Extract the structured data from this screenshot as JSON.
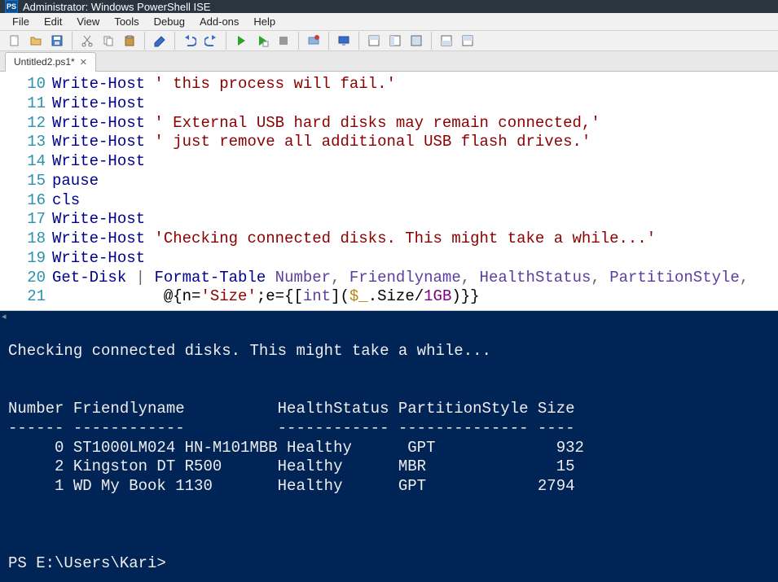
{
  "titlebar": {
    "title": "Administrator: Windows PowerShell ISE",
    "icon_label": "PS"
  },
  "menubar": {
    "items": [
      "File",
      "Edit",
      "View",
      "Tools",
      "Debug",
      "Add-ons",
      "Help"
    ]
  },
  "toolbar": {
    "new": "New",
    "open": "Open",
    "save": "Save",
    "cut": "Cut",
    "copy": "Copy",
    "paste": "Paste",
    "clear": "Clear",
    "undo": "Undo",
    "redo": "Redo",
    "run": "Run",
    "runsel": "Run Selection",
    "stop": "Stop",
    "break": "Break",
    "remote": "Remote",
    "paneA": "Pane",
    "paneB": "Pane",
    "paneC": "Pane",
    "paneD": "Pane",
    "paneE": "Pane"
  },
  "tabs": {
    "current": "Untitled2.ps1*"
  },
  "code": {
    "lines": [
      {
        "n": "10",
        "t": [
          [
            "cmd",
            "Write-Host"
          ],
          [
            "str",
            " ' this process will fail.'"
          ]
        ]
      },
      {
        "n": "11",
        "t": [
          [
            "cmd",
            "Write-Host"
          ]
        ]
      },
      {
        "n": "12",
        "t": [
          [
            "cmd",
            "Write-Host"
          ],
          [
            "str",
            " ' External USB hard disks may remain connected,'"
          ]
        ]
      },
      {
        "n": "13",
        "t": [
          [
            "cmd",
            "Write-Host"
          ],
          [
            "str",
            " ' just remove all additional USB flash drives.'"
          ]
        ]
      },
      {
        "n": "14",
        "t": [
          [
            "cmd",
            "Write-Host"
          ]
        ]
      },
      {
        "n": "15",
        "t": [
          [
            "cmd",
            "pause"
          ]
        ]
      },
      {
        "n": "16",
        "t": [
          [
            "cmd",
            "cls"
          ]
        ]
      },
      {
        "n": "17",
        "t": [
          [
            "cmd",
            "Write-Host"
          ]
        ]
      },
      {
        "n": "18",
        "t": [
          [
            "cmd",
            "Write-Host"
          ],
          [
            "str",
            " 'Checking connected disks. This might take a while...'"
          ]
        ]
      },
      {
        "n": "19",
        "t": [
          [
            "cmd",
            "Write-Host"
          ]
        ]
      },
      {
        "n": "20",
        "t": [
          [
            "cmd",
            "Get-Disk"
          ],
          [
            "",
            " "
          ],
          [
            "pipe",
            "|"
          ],
          [
            "",
            " "
          ],
          [
            "cmd",
            "Format-Table"
          ],
          [
            "",
            " "
          ],
          [
            "id",
            "Number"
          ],
          [
            "pipe",
            ","
          ],
          [
            "",
            " "
          ],
          [
            "id",
            "Friendlyname"
          ],
          [
            "pipe",
            ","
          ],
          [
            "",
            " "
          ],
          [
            "id",
            "HealthStatus"
          ],
          [
            "pipe",
            ","
          ],
          [
            "",
            " "
          ],
          [
            "id",
            "PartitionStyle"
          ],
          [
            "pipe",
            ","
          ]
        ]
      },
      {
        "n": "21",
        "t": [
          [
            "",
            "            @{n="
          ],
          [
            "str",
            "'Size'"
          ],
          [
            "",
            ";e={["
          ],
          [
            "id",
            "int"
          ],
          [
            "",
            "]("
          ],
          [
            "var",
            "$_"
          ],
          [
            "",
            ".Size/"
          ],
          [
            "num",
            "1GB"
          ],
          [
            "",
            ")}}"
          ]
        ]
      }
    ]
  },
  "console": {
    "lines": [
      "",
      "Checking connected disks. This might take a while...",
      "",
      "",
      "Number Friendlyname          HealthStatus PartitionStyle Size",
      "------ ------------          ------------ -------------- ----",
      "     0 ST1000LM024 HN-M101MBB Healthy      GPT             932",
      "     2 Kingston DT R500      Healthy      MBR              15",
      "     1 WD My Book 1130       Healthy      GPT            2794",
      "",
      "",
      "",
      "PS E:\\Users\\Kari> "
    ]
  }
}
